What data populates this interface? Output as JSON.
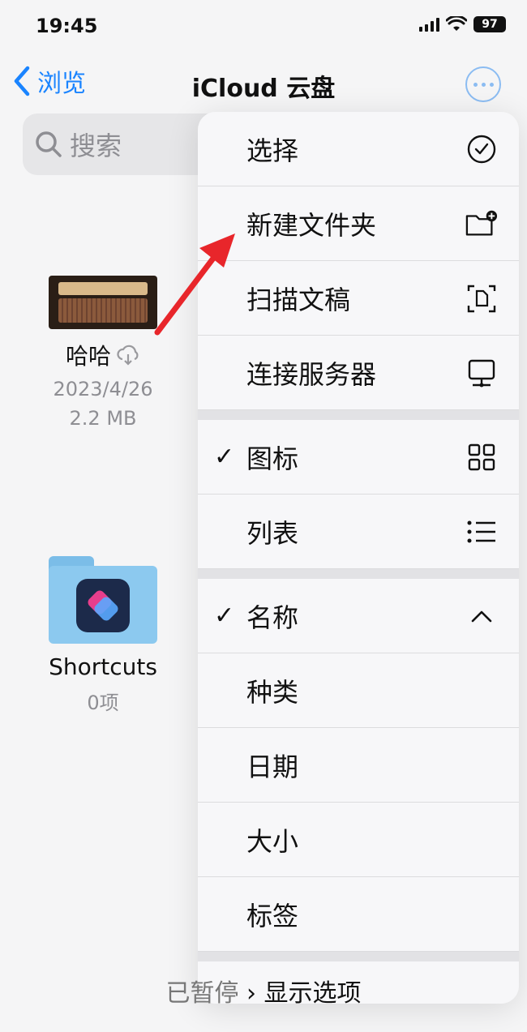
{
  "status_bar": {
    "time": "19:45",
    "battery": "97"
  },
  "nav": {
    "back_label": "浏览",
    "title": "iCloud 云盘"
  },
  "search": {
    "placeholder": "搜索"
  },
  "files": [
    {
      "name": "哈哈",
      "date": "2023/4/26",
      "size": "2.2 MB"
    },
    {
      "name": "Shortcuts",
      "count": "0项"
    }
  ],
  "menu": {
    "group1": [
      {
        "label": "选择",
        "icon": "checkmark-circle-icon"
      },
      {
        "label": "新建文件夹",
        "icon": "new-folder-icon"
      },
      {
        "label": "扫描文稿",
        "icon": "scan-document-icon"
      },
      {
        "label": "连接服务器",
        "icon": "server-icon"
      }
    ],
    "group2": [
      {
        "label": "图标",
        "checked": true,
        "icon": "grid-icon"
      },
      {
        "label": "列表",
        "checked": false,
        "icon": "list-icon"
      }
    ],
    "group3": [
      {
        "label": "名称",
        "checked": true,
        "icon": "chevron-up-icon"
      },
      {
        "label": "种类"
      },
      {
        "label": "日期"
      },
      {
        "label": "大小"
      },
      {
        "label": "标签"
      }
    ],
    "check_mark": "✓"
  },
  "bottom": {
    "text_faded": "已暂停",
    "text": "显示选项"
  },
  "colors": {
    "accent": "#1a84ff",
    "annotation_arrow": "#e8262b"
  }
}
